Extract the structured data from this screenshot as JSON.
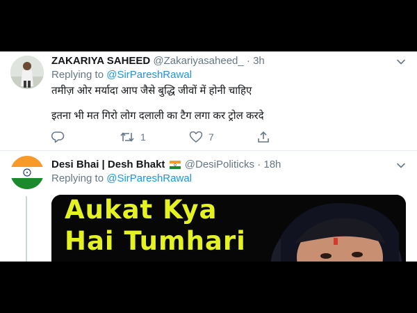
{
  "tweets": [
    {
      "name": "ZAKARIYA SAHEED",
      "handle": "@Zakariyasaheed_",
      "separator": " · ",
      "time": "3h",
      "replying_to_label": "Replying to",
      "replying_to_handle": "@SirPareshRawal",
      "lines": [
        "तमीज़ ओर मर्यादा आप जैसे बुद्धि जीवों में होनी चाहिए",
        "इतना भी मत गिरो लोग दलाली का टैग लगा कर ट्रोल करदे"
      ],
      "actions": {
        "retweets": "1",
        "likes": "7"
      },
      "icons": [
        "reply-icon",
        "retweet-icon",
        "like-icon",
        "share-icon",
        "chevron-down-icon"
      ]
    },
    {
      "name": "Desi Bhai | Desh Bhakt",
      "handle": "@DesiPoliticks",
      "separator": " · ",
      "time": "18h",
      "replying_to_label": "Replying to",
      "replying_to_handle": "@SirPareshRawal",
      "media_caption": [
        "Aukat Kya",
        "Hai Tumhari"
      ],
      "icons": [
        "india-flag-icon",
        "chevron-down-icon"
      ]
    }
  ],
  "colors": {
    "text": "#14171a",
    "secondary": "#657786",
    "link": "#1b95e0",
    "caption": "#e5f222",
    "border": "#e6ecf0"
  }
}
